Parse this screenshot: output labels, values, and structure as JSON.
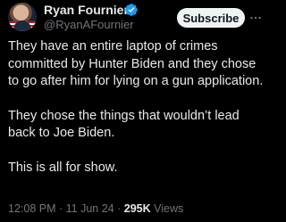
{
  "author": {
    "display_name": "Ryan Fournier",
    "handle": "@RyanAFournier",
    "verified": true
  },
  "actions": {
    "subscribe_label": "Subscribe"
  },
  "tweet": {
    "paragraphs": [
      "They have an entire laptop of crimes committed by Hunter Biden and they chose to go after him for lying on a gun application.",
      "They chose the things that wouldn’t lead back to Joe Biden.",
      "This is all for show."
    ]
  },
  "meta": {
    "time": "12:08 PM",
    "separator": "·",
    "date": "11 Jun 24",
    "views_count": "295K",
    "views_label": "Views"
  },
  "colors": {
    "background": "#000000",
    "text_primary": "#e7e9ea",
    "text_secondary": "#71767b",
    "verified_badge": "#1d9bf0",
    "subscribe_bg": "#eff3f4"
  },
  "icons": {
    "verified": "verified-badge-icon",
    "more": "more-dots-icon"
  }
}
